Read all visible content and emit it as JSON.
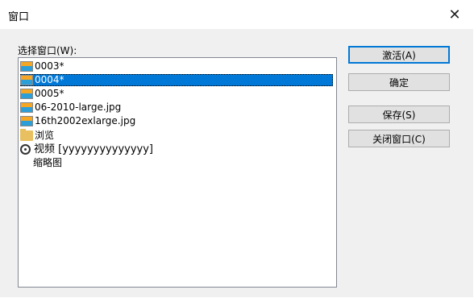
{
  "window": {
    "title": "窗口",
    "close_glyph": "✕"
  },
  "list": {
    "label": "选择窗口(W):",
    "items": [
      {
        "label": "0003*",
        "icon": "image-icon",
        "selected": false
      },
      {
        "label": "0004*",
        "icon": "image-icon",
        "selected": true
      },
      {
        "label": "0005*",
        "icon": "image-icon",
        "selected": false
      },
      {
        "label": "06-2010-large.jpg",
        "icon": "image-icon",
        "selected": false
      },
      {
        "label": "16th2002exlarge.jpg",
        "icon": "image-icon",
        "selected": false
      },
      {
        "label": "浏览",
        "icon": "folder-icon",
        "selected": false
      },
      {
        "label": "视频 [yyyyyyyyyyyyyy]",
        "icon": "video-icon",
        "selected": false
      },
      {
        "label": "缩略图",
        "icon": "thumbnails-icon",
        "selected": false
      }
    ]
  },
  "buttons": {
    "activate": "激活(A)",
    "ok": "确定",
    "save": "保存(S)",
    "close_window": "关闭窗口(C)"
  },
  "colors": {
    "selection": "#0078d7",
    "client_bg": "#f0f0f0"
  }
}
